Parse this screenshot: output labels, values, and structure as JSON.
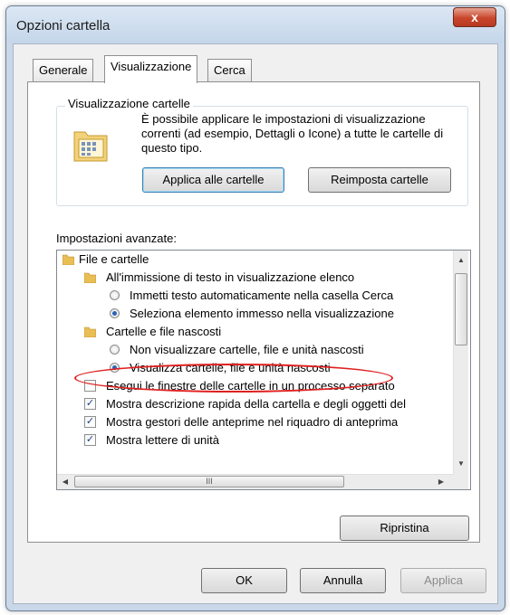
{
  "window": {
    "title": "Opzioni cartella",
    "close_symbol": "x"
  },
  "tabs": [
    {
      "label": "Generale"
    },
    {
      "label": "Visualizzazione"
    },
    {
      "label": "Cerca"
    }
  ],
  "folder_view": {
    "group_label": "Visualizzazione cartelle",
    "description": "È possibile applicare le impostazioni di visualizzazione correnti (ad esempio, Dettagli o Icone) a tutte le cartelle di questo tipo.",
    "apply_button": "Applica alle cartelle",
    "reset_button": "Reimposta cartelle"
  },
  "advanced": {
    "label": "Impostazioni avanzate:",
    "items": [
      {
        "text": "File e cartelle"
      },
      {
        "text": "All'immissione di testo in visualizzazione elenco"
      },
      {
        "text": "Immetti testo automaticamente nella casella Cerca"
      },
      {
        "text": "Seleziona elemento immesso nella visualizzazione"
      },
      {
        "text": "Cartelle e file nascosti"
      },
      {
        "text": "Non visualizzare cartelle, file e unità nascosti"
      },
      {
        "text": "Visualizza cartelle, file e unità nascosti"
      },
      {
        "text": "Esegui le finestre delle cartelle in un processo separato"
      },
      {
        "text": "Mostra descrizione rapida della cartella e degli oggetti del"
      },
      {
        "text": "Mostra gestori delle anteprime nel riquadro di anteprima"
      },
      {
        "text": "Mostra lettere di unità"
      }
    ],
    "scroll_grip": "III"
  },
  "buttons": {
    "restore": "Ripristina",
    "ok": "OK",
    "cancel": "Annulla",
    "apply": "Applica"
  },
  "colors": {
    "highlight_ellipse": "#e02020",
    "checkmark": "#1d3f8a"
  }
}
